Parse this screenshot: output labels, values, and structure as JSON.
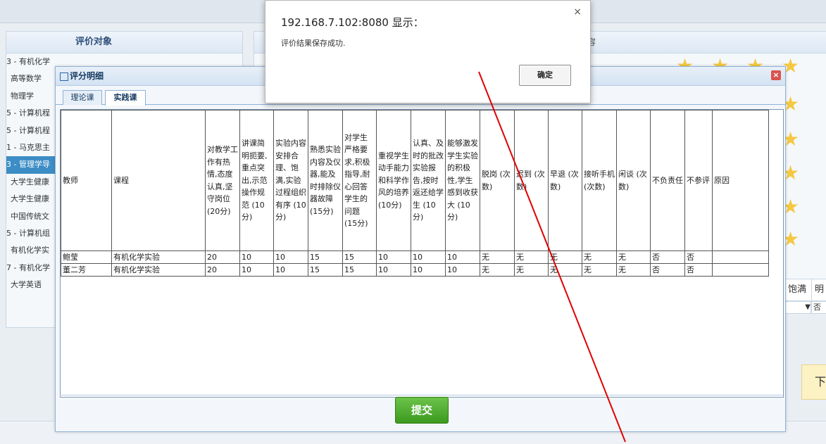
{
  "left_panel": {
    "title": "评价对象",
    "items": [
      "3 - 有机化学",
      "高等数学",
      "物理学",
      "5 - 计算机程",
      "5 - 计算机程",
      "1 - 马克思主",
      "3 - 管理学导",
      "大学生健康",
      "大学生健康",
      "中国传统文",
      "5 - 计算机组",
      "有机化学实",
      "7 - 有机化学",
      "大学英语"
    ]
  },
  "right_panel": {
    "header_fragment": "容",
    "partial_texts": [
      "饱满",
      "明",
      "否"
    ],
    "yellow_button_fragment": "下"
  },
  "dialog": {
    "title": "评分明细",
    "tabs": [
      "理论课",
      "实践课"
    ],
    "columns": [
      "教师",
      "课程",
      "对教学工作有热情,态度认真,坚守岗位 (20分)",
      "讲课简明扼要,重点突出,示范操作规范 (10分)",
      "实验内容安排合理、饱满,实验过程组织有序 (10分)",
      "熟悉实验内容及仪器,能及时排除仪器故障 (15分)",
      "对学生严格要求,积极指导,耐心回答学生的问题 (15分)",
      "重视学生动手能力和科学作风的培养 (10分)",
      "认真、及时的批改实验报告,按时返还给学生 (10分)",
      "能够激发学生实验的积极性,学生感到收获大 (10分)",
      "脱岗 (次数)",
      "迟到 (次数)",
      "早退 (次数)",
      "接听手机(次数)",
      "闲谈 (次数)",
      "不负责任",
      "不参评",
      "原因"
    ],
    "rows": [
      [
        "鲍莹",
        "有机化学实验",
        "20",
        "10",
        "10",
        "15",
        "15",
        "10",
        "10",
        "10",
        "无",
        "无",
        "无",
        "无",
        "无",
        "否",
        "否",
        ""
      ],
      [
        "董二芳",
        "有机化学实验",
        "20",
        "10",
        "10",
        "15",
        "15",
        "10",
        "10",
        "10",
        "无",
        "无",
        "无",
        "无",
        "无",
        "否",
        "否",
        ""
      ]
    ],
    "submit_label": "提交"
  },
  "alert": {
    "title": "192.168.7.102:8080 显示：",
    "message": "评价结果保存成功.",
    "ok_label": "确定",
    "close_glyph": "×"
  },
  "colors": {
    "annotation_arrow": "#e00000",
    "submit_green": "#3b9a1f",
    "selected_blue": "#3c8dc5"
  }
}
